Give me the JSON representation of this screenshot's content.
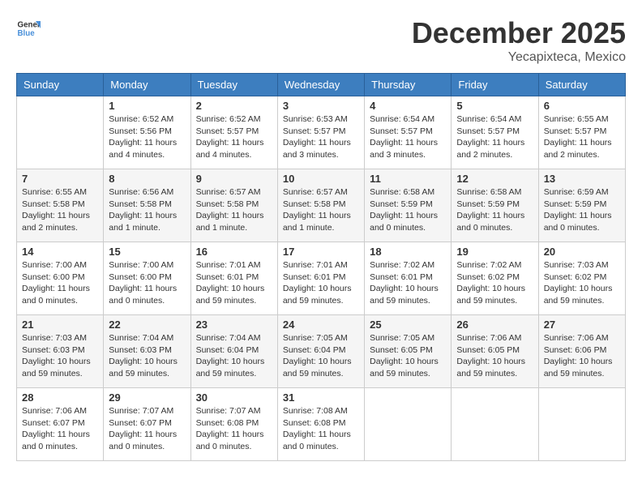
{
  "header": {
    "logo": {
      "general": "General",
      "blue": "Blue"
    },
    "title": "December 2025",
    "subtitle": "Yecapixteca, Mexico"
  },
  "days_of_week": [
    "Sunday",
    "Monday",
    "Tuesday",
    "Wednesday",
    "Thursday",
    "Friday",
    "Saturday"
  ],
  "weeks": [
    [
      {
        "day": "",
        "info": ""
      },
      {
        "day": "1",
        "info": "Sunrise: 6:52 AM\nSunset: 5:56 PM\nDaylight: 11 hours\nand 4 minutes."
      },
      {
        "day": "2",
        "info": "Sunrise: 6:52 AM\nSunset: 5:57 PM\nDaylight: 11 hours\nand 4 minutes."
      },
      {
        "day": "3",
        "info": "Sunrise: 6:53 AM\nSunset: 5:57 PM\nDaylight: 11 hours\nand 3 minutes."
      },
      {
        "day": "4",
        "info": "Sunrise: 6:54 AM\nSunset: 5:57 PM\nDaylight: 11 hours\nand 3 minutes."
      },
      {
        "day": "5",
        "info": "Sunrise: 6:54 AM\nSunset: 5:57 PM\nDaylight: 11 hours\nand 2 minutes."
      },
      {
        "day": "6",
        "info": "Sunrise: 6:55 AM\nSunset: 5:57 PM\nDaylight: 11 hours\nand 2 minutes."
      }
    ],
    [
      {
        "day": "7",
        "info": "Sunrise: 6:55 AM\nSunset: 5:58 PM\nDaylight: 11 hours\nand 2 minutes."
      },
      {
        "day": "8",
        "info": "Sunrise: 6:56 AM\nSunset: 5:58 PM\nDaylight: 11 hours\nand 1 minute."
      },
      {
        "day": "9",
        "info": "Sunrise: 6:57 AM\nSunset: 5:58 PM\nDaylight: 11 hours\nand 1 minute."
      },
      {
        "day": "10",
        "info": "Sunrise: 6:57 AM\nSunset: 5:58 PM\nDaylight: 11 hours\nand 1 minute."
      },
      {
        "day": "11",
        "info": "Sunrise: 6:58 AM\nSunset: 5:59 PM\nDaylight: 11 hours\nand 0 minutes."
      },
      {
        "day": "12",
        "info": "Sunrise: 6:58 AM\nSunset: 5:59 PM\nDaylight: 11 hours\nand 0 minutes."
      },
      {
        "day": "13",
        "info": "Sunrise: 6:59 AM\nSunset: 5:59 PM\nDaylight: 11 hours\nand 0 minutes."
      }
    ],
    [
      {
        "day": "14",
        "info": "Sunrise: 7:00 AM\nSunset: 6:00 PM\nDaylight: 11 hours\nand 0 minutes."
      },
      {
        "day": "15",
        "info": "Sunrise: 7:00 AM\nSunset: 6:00 PM\nDaylight: 11 hours\nand 0 minutes."
      },
      {
        "day": "16",
        "info": "Sunrise: 7:01 AM\nSunset: 6:01 PM\nDaylight: 10 hours\nand 59 minutes."
      },
      {
        "day": "17",
        "info": "Sunrise: 7:01 AM\nSunset: 6:01 PM\nDaylight: 10 hours\nand 59 minutes."
      },
      {
        "day": "18",
        "info": "Sunrise: 7:02 AM\nSunset: 6:01 PM\nDaylight: 10 hours\nand 59 minutes."
      },
      {
        "day": "19",
        "info": "Sunrise: 7:02 AM\nSunset: 6:02 PM\nDaylight: 10 hours\nand 59 minutes."
      },
      {
        "day": "20",
        "info": "Sunrise: 7:03 AM\nSunset: 6:02 PM\nDaylight: 10 hours\nand 59 minutes."
      }
    ],
    [
      {
        "day": "21",
        "info": "Sunrise: 7:03 AM\nSunset: 6:03 PM\nDaylight: 10 hours\nand 59 minutes."
      },
      {
        "day": "22",
        "info": "Sunrise: 7:04 AM\nSunset: 6:03 PM\nDaylight: 10 hours\nand 59 minutes."
      },
      {
        "day": "23",
        "info": "Sunrise: 7:04 AM\nSunset: 6:04 PM\nDaylight: 10 hours\nand 59 minutes."
      },
      {
        "day": "24",
        "info": "Sunrise: 7:05 AM\nSunset: 6:04 PM\nDaylight: 10 hours\nand 59 minutes."
      },
      {
        "day": "25",
        "info": "Sunrise: 7:05 AM\nSunset: 6:05 PM\nDaylight: 10 hours\nand 59 minutes."
      },
      {
        "day": "26",
        "info": "Sunrise: 7:06 AM\nSunset: 6:05 PM\nDaylight: 10 hours\nand 59 minutes."
      },
      {
        "day": "27",
        "info": "Sunrise: 7:06 AM\nSunset: 6:06 PM\nDaylight: 10 hours\nand 59 minutes."
      }
    ],
    [
      {
        "day": "28",
        "info": "Sunrise: 7:06 AM\nSunset: 6:07 PM\nDaylight: 11 hours\nand 0 minutes."
      },
      {
        "day": "29",
        "info": "Sunrise: 7:07 AM\nSunset: 6:07 PM\nDaylight: 11 hours\nand 0 minutes."
      },
      {
        "day": "30",
        "info": "Sunrise: 7:07 AM\nSunset: 6:08 PM\nDaylight: 11 hours\nand 0 minutes."
      },
      {
        "day": "31",
        "info": "Sunrise: 7:08 AM\nSunset: 6:08 PM\nDaylight: 11 hours\nand 0 minutes."
      },
      {
        "day": "",
        "info": ""
      },
      {
        "day": "",
        "info": ""
      },
      {
        "day": "",
        "info": ""
      }
    ]
  ]
}
